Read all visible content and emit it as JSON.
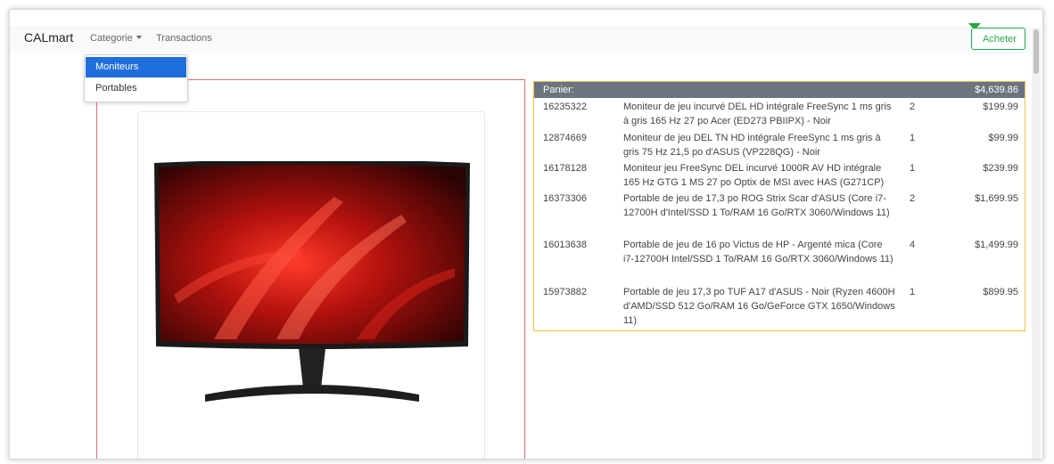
{
  "navbar": {
    "brand": "CALmart",
    "categorie_label": "Categorie",
    "transactions_label": "Transactions",
    "buy_label": "Acheter"
  },
  "dropdown": {
    "items": [
      {
        "label": "Moniteurs",
        "active": true
      },
      {
        "label": "Portables",
        "active": false
      }
    ]
  },
  "cart": {
    "title": "Panier:",
    "total": "$4,639.86",
    "rows": [
      {
        "id": "16235322",
        "desc": "Moniteur de jeu incurvé DEL HD intégrale FreeSync 1 ms gris à gris 165 Hz 27 po Acer (ED273 PBIIPX) - Noir",
        "qty": "2",
        "price": "$199.99"
      },
      {
        "id": "12874669",
        "desc": "Moniteur de jeu DEL TN HD intégrale FreeSync 1 ms gris à gris 75 Hz 21,5 po d'ASUS (VP228QG) - Noir",
        "qty": "1",
        "price": "$99.99"
      },
      {
        "id": "16178128",
        "desc": "Moniteur jeu FreeSync DEL incurvé 1000R AV HD intégrale 165 Hz GTG 1 MS 27 po Optix de MSI avec HAS (G271CP)",
        "qty": "1",
        "price": "$239.99"
      },
      {
        "id": "16373306",
        "desc": "Portable de jeu de 17,3 po ROG Strix Scar d'ASUS (Core i7-12700H d'Intel/SSD 1 To/RAM 16 Go/RTX 3060/Windows 11)",
        "qty": "2",
        "price": "$1,699.95"
      },
      {
        "id": "16013638",
        "desc": "Portable de jeu de 16 po Victus de HP - Argenté mica (Core i7-12700H Intel/SSD 1 To/RAM 16 Go/RTX 3060/Windows 11)",
        "qty": "4",
        "price": "$1,499.99"
      },
      {
        "id": "15973882",
        "desc": "Portable de jeu 17,3 po TUF A17 d'ASUS - Noir (Ryzen 4600H d'AMD/SSD 512 Go/RAM 16 Go/GeForce GTX 1650/Windows 11)",
        "qty": "1",
        "price": "$899.95"
      }
    ]
  },
  "colors": {
    "accent_blue": "#1e6fdb",
    "buy_green": "#28a745",
    "cart_border": "#f0c040",
    "product_border": "#e06d6d",
    "cart_header": "#6c757d"
  }
}
